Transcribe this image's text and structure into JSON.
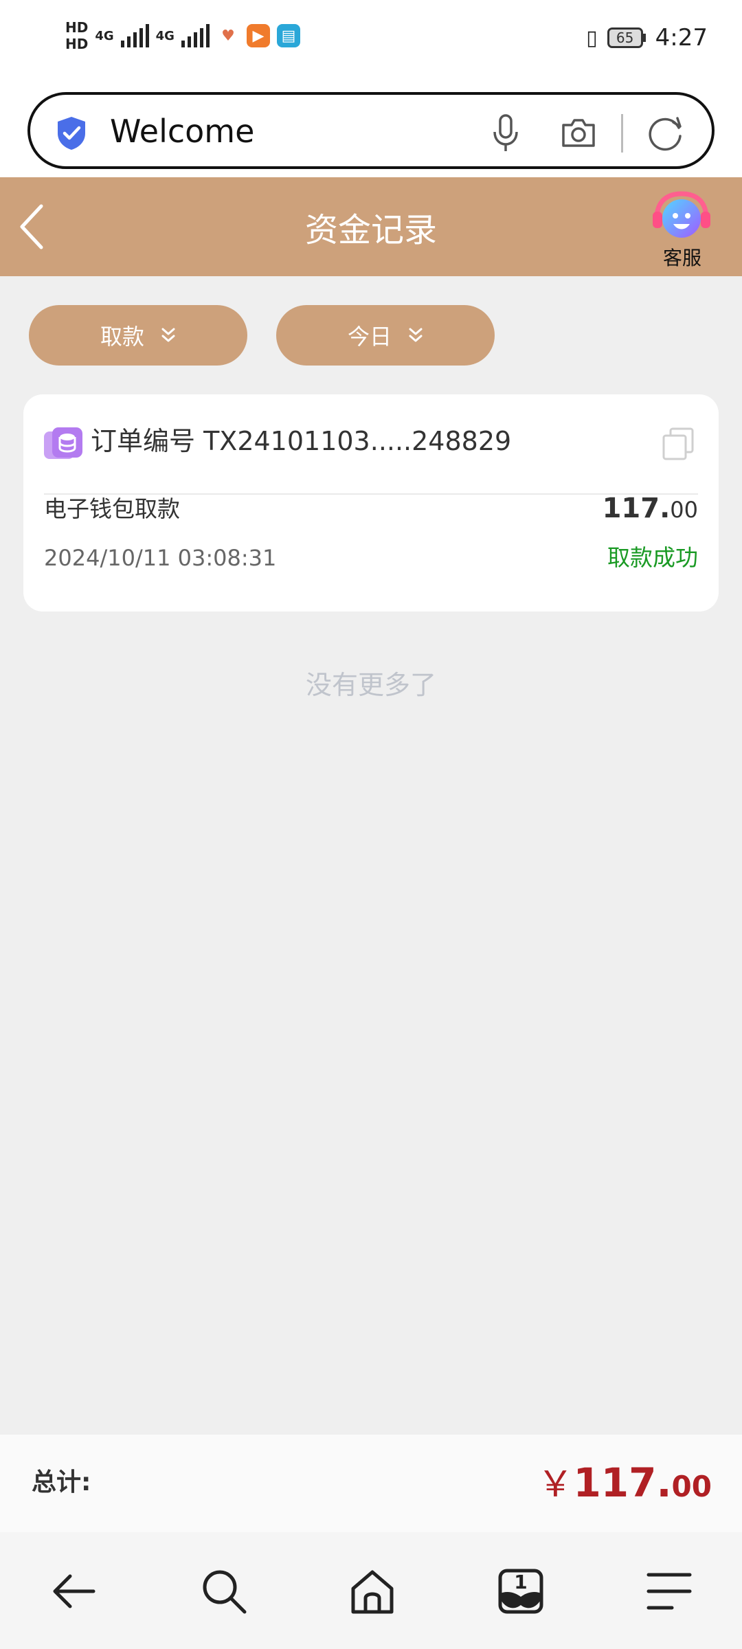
{
  "status_bar": {
    "sim1": "HD",
    "sim2": "HD",
    "net1": "4G",
    "net2": "4G",
    "battery": "65",
    "time": "4:27"
  },
  "browser": {
    "url_text": "Welcome"
  },
  "header": {
    "title": "资金记录",
    "customer_service_label": "客服"
  },
  "filters": [
    {
      "label": "取款"
    },
    {
      "label": "今日"
    }
  ],
  "record": {
    "order_label": "订单编号 TX24101103.....248829",
    "type": "电子钱包取款",
    "amount_int": "117.",
    "amount_dec": "00",
    "datetime": "2024/10/11 03:08:31",
    "status": "取款成功"
  },
  "no_more_text": "没有更多了",
  "total": {
    "label": "总计:",
    "symbol": "￥",
    "int": "117.",
    "dec": "00"
  },
  "colors": {
    "accent": "#cda17b",
    "success": "#1a9a24",
    "total_red": "#b02024"
  },
  "icons": [
    "shield-check-icon",
    "microphone-icon",
    "camera-icon",
    "refresh-icon",
    "back-arrow-icon",
    "customer-service-icon",
    "double-chevron-down-icon",
    "coin-stack-icon",
    "copy-icon",
    "nav-back-icon",
    "nav-search-icon",
    "nav-home-icon",
    "nav-tabs-icon",
    "nav-menu-icon"
  ],
  "nav": {
    "tabs_count": "1"
  }
}
